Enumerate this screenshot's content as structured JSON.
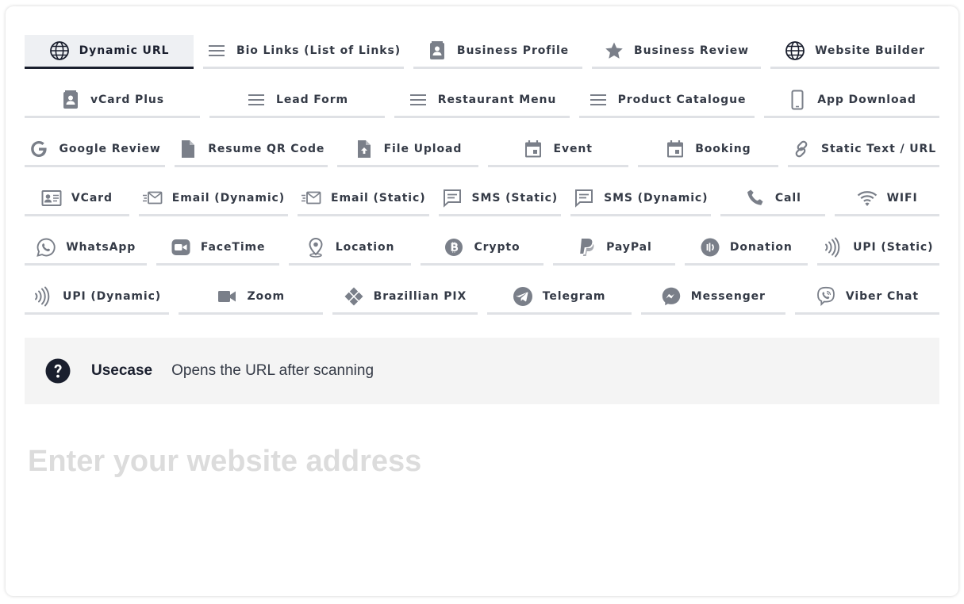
{
  "tabs": [
    [
      {
        "label": "Dynamic URL",
        "icon": "globe",
        "active": true
      },
      {
        "label": "Bio Links (List of Links)",
        "icon": "menu"
      },
      {
        "label": "Business Profile",
        "icon": "contact-card"
      },
      {
        "label": "Business Review",
        "icon": "star"
      },
      {
        "label": "Website Builder",
        "icon": "globe"
      }
    ],
    [
      {
        "label": "vCard Plus",
        "icon": "contact-card"
      },
      {
        "label": "Lead Form",
        "icon": "menu"
      },
      {
        "label": "Restaurant Menu",
        "icon": "menu"
      },
      {
        "label": "Product Catalogue",
        "icon": "menu"
      },
      {
        "label": "App Download",
        "icon": "phone"
      }
    ],
    [
      {
        "label": "Google Review",
        "icon": "google"
      },
      {
        "label": "Resume QR Code",
        "icon": "document"
      },
      {
        "label": "File Upload",
        "icon": "file-upload"
      },
      {
        "label": "Event",
        "icon": "calendar"
      },
      {
        "label": "Booking",
        "icon": "calendar"
      },
      {
        "label": "Static Text / URL",
        "icon": "link"
      }
    ],
    [
      {
        "label": "VCard",
        "icon": "id-card"
      },
      {
        "label": "Email (Dynamic)",
        "icon": "email-fast"
      },
      {
        "label": "Email (Static)",
        "icon": "email-fast"
      },
      {
        "label": "SMS (Static)",
        "icon": "chat"
      },
      {
        "label": "SMS (Dynamic)",
        "icon": "chat"
      },
      {
        "label": "Call",
        "icon": "phone-call"
      },
      {
        "label": "WIFI",
        "icon": "wifi"
      }
    ],
    [
      {
        "label": "WhatsApp",
        "icon": "whatsapp"
      },
      {
        "label": "FaceTime",
        "icon": "facetime"
      },
      {
        "label": "Location",
        "icon": "location-pin"
      },
      {
        "label": "Crypto",
        "icon": "bitcoin"
      },
      {
        "label": "PayPal",
        "icon": "paypal"
      },
      {
        "label": "Donation",
        "icon": "donation"
      },
      {
        "label": "UPI (Static)",
        "icon": "contactless"
      }
    ],
    [
      {
        "label": "UPI (Dynamic)",
        "icon": "contactless"
      },
      {
        "label": "Zoom",
        "icon": "video"
      },
      {
        "label": "Brazillian PIX",
        "icon": "pix"
      },
      {
        "label": "Telegram",
        "icon": "telegram"
      },
      {
        "label": "Messenger",
        "icon": "messenger"
      },
      {
        "label": "Viber Chat",
        "icon": "viber"
      }
    ]
  ],
  "usecase": {
    "icon": "question-circle",
    "label": "Usecase",
    "text": "Opens the URL after scanning"
  },
  "url_input": {
    "placeholder": "Enter your website address",
    "value": ""
  },
  "colors": {
    "icon_gray": "#7a7f89",
    "text_dark": "#343a46",
    "active_underline": "#1a1f2e",
    "tab_underline": "#dfe1e5",
    "usecase_bg": "#f4f4f4",
    "placeholder": "#dcdcdc"
  }
}
